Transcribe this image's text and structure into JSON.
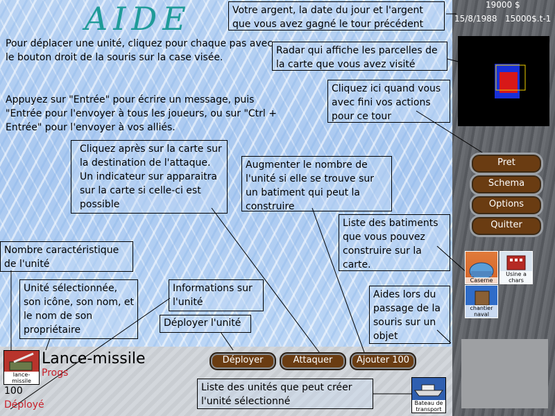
{
  "title": "AIDE",
  "intro": {
    "move": "Pour déplacer une unité, cliquez pour chaque pas avec le bouton droit de la souris sur la case visée.",
    "message": "Appuyez sur \"Entrée\" pour écrire un message, puis \"Entrée pour l'envoyer à tous les joueurs, ou sur \"Ctrl + Entrée\" pour l'envoyer à vos alliés."
  },
  "help": {
    "money_date": "Votre argent, la date du jour et l'argent que vous avez gagné le tour précédent",
    "radar": "Radar qui affiche les parcelles de la carte que vous avez visité",
    "ready": "Cliquez ici quand vous avec fini vos actions pour ce tour",
    "attack": "Cliquez après sur la carte sur la destination de l'attaque. Un indicateur sur apparaitra sur la carte si celle-ci est possible",
    "add": "Augmenter le nombre de l'unité si elle se trouve sur un batiment qui peut la construire",
    "buildings": "Liste des batiments que vous pouvez construire sur la carte.",
    "characteristic": "Nombre caractéristique de l'unité",
    "selected": "Unité sélectionnée, son icône, son nom, et le nom de son propriétaire",
    "info": "Informations sur l'unité",
    "deploy": "Déployer l'unité",
    "hover": "Aides lors du passage de la souris sur un objet",
    "produce": "Liste des unités que peut créer l'unité sélectionné"
  },
  "status": {
    "money": "19000 $",
    "date": "15/8/1988",
    "income": "15000$.t-1"
  },
  "side_buttons": [
    "Pret",
    "Schema",
    "Options",
    "Quitter"
  ],
  "buildings": [
    {
      "label": "Caserne",
      "icon": "barracks-icon"
    },
    {
      "label": "Usine a chars",
      "icon": "tank-factory-icon"
    },
    {
      "label": "chantier naval",
      "icon": "shipyard-icon"
    }
  ],
  "unit": {
    "name": "Lance-missile",
    "owner": "Progs",
    "value": "100",
    "state": "Déployé",
    "icon_label": "lance-missile",
    "icon": "missile-launcher-icon"
  },
  "actions": [
    "Déployer",
    "Attaquer",
    "Ajouter 100"
  ],
  "producible": {
    "label": "Bateau de transport",
    "icon": "transport-ship-icon"
  },
  "colors": {
    "title": "#1f9b98",
    "button": "#6a3c12",
    "status_red": "#c8202a"
  }
}
